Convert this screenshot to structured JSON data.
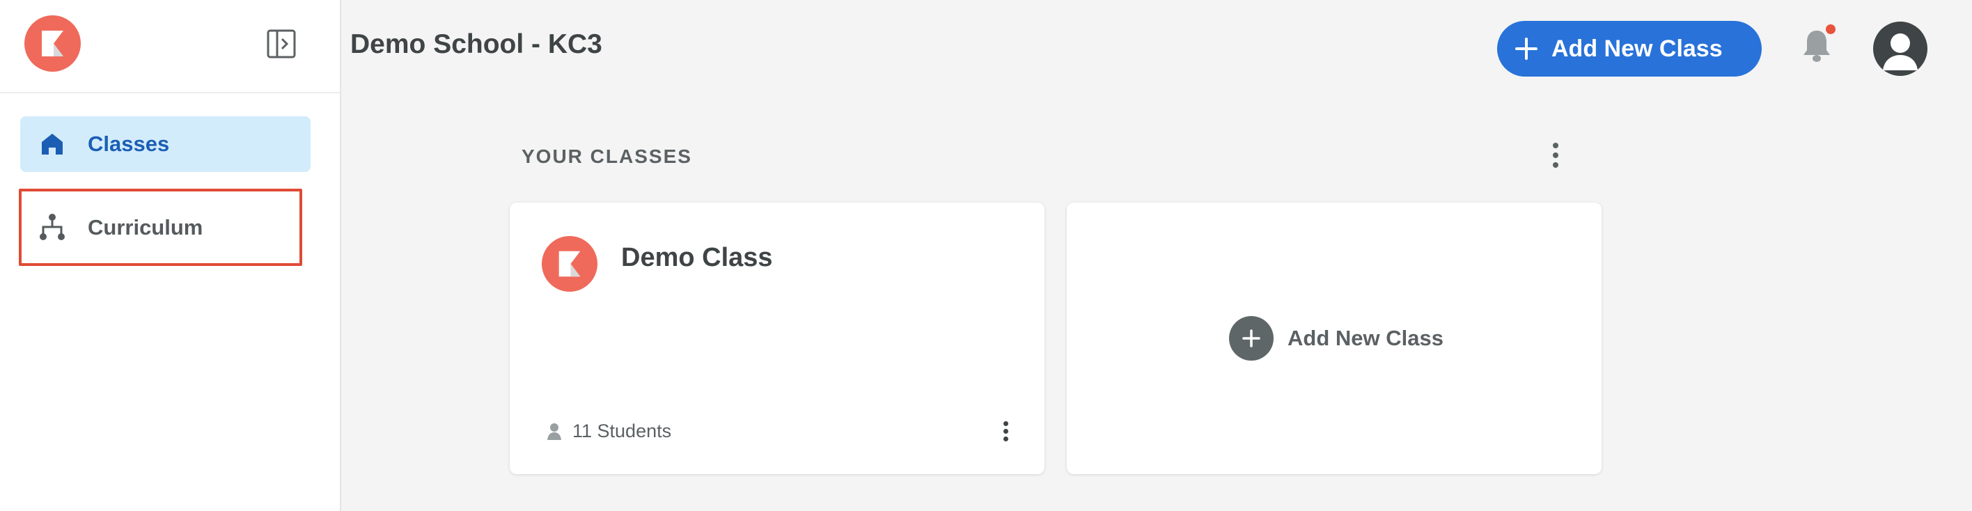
{
  "sidebar": {
    "logo_icon": "kolibri-logo-icon",
    "collapse_icon": "sidebar-collapse-icon",
    "items": [
      {
        "label": "Classes",
        "icon": "home-icon",
        "active": true
      },
      {
        "label": "Curriculum",
        "icon": "hierarchy-icon",
        "active": false,
        "highlighted": true
      }
    ]
  },
  "header": {
    "title": "Demo School - KC3",
    "add_class_label": "Add New Class",
    "notification_icon": "bell-icon",
    "avatar_icon": "user-avatar-icon"
  },
  "main": {
    "section_title": "YOUR CLASSES",
    "classes": [
      {
        "name": "Demo Class",
        "students": "11 Students"
      }
    ],
    "add_card_label": "Add New Class"
  },
  "colors": {
    "brand": "#ef6a5b",
    "primary_button": "#2872da",
    "active_nav_bg": "#d3ecfb",
    "active_nav_text": "#1b5eb4",
    "highlight_border": "#e04b35",
    "notification_dot": "#e8533d",
    "page_bg": "#f3f4f3"
  }
}
